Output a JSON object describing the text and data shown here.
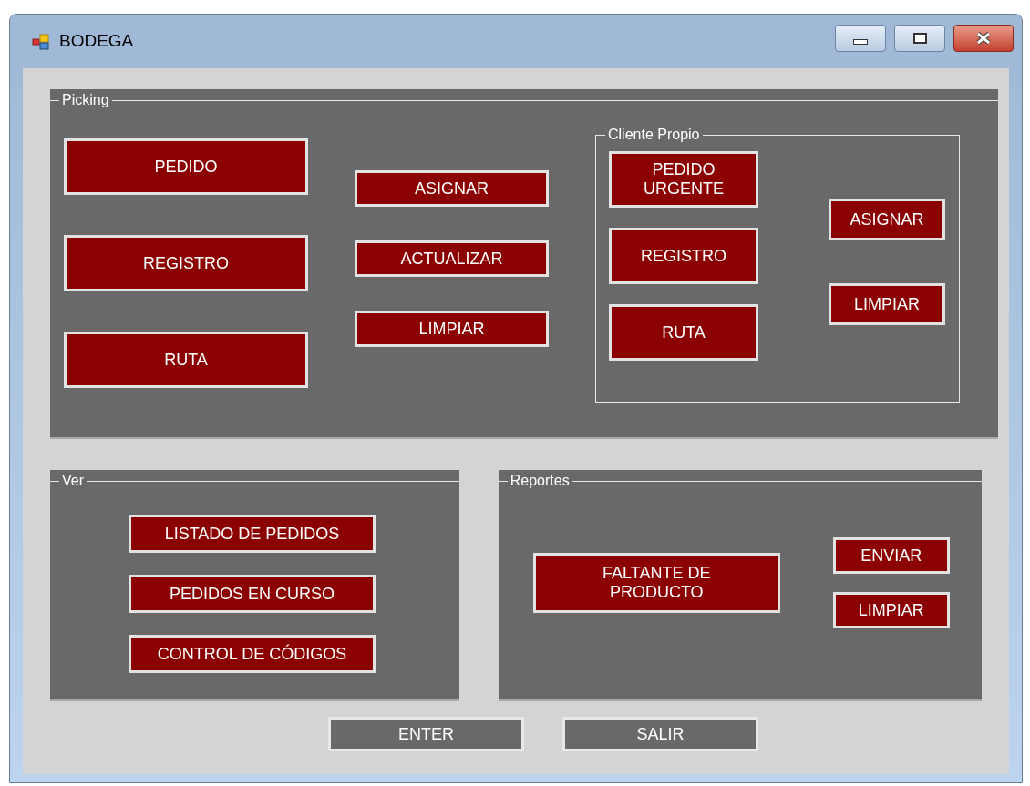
{
  "window": {
    "title": "BODEGA"
  },
  "picking": {
    "title": "Picking",
    "columns": [
      [
        {
          "label": "PEDIDO",
          "kind": "accent"
        },
        {
          "label": "REGISTRO",
          "kind": "accent"
        },
        {
          "label": "RUTA",
          "kind": "accent"
        }
      ],
      [
        {
          "label": "ASIGNAR",
          "kind": "accent"
        },
        {
          "label": "ACTUALIZAR",
          "kind": "accent"
        },
        {
          "label": "LIMPIAR",
          "kind": "accent"
        }
      ]
    ],
    "cliente_propio": {
      "title": "Cliente Propio",
      "columns": [
        [
          {
            "label": "PEDIDO\nURGENTE",
            "kind": "accent"
          },
          {
            "label": "REGISTRO",
            "kind": "accent"
          },
          {
            "label": "RUTA",
            "kind": "accent"
          }
        ],
        [
          {
            "label": "ASIGNAR",
            "kind": "accent"
          },
          {
            "label": "LIMPIAR",
            "kind": "accent"
          }
        ]
      ]
    }
  },
  "ver": {
    "title": "Ver",
    "buttons": [
      {
        "label": "LISTADO DE PEDIDOS",
        "kind": "accent"
      },
      {
        "label": "PEDIDOS EN CURSO",
        "kind": "accent"
      },
      {
        "label": "CONTROL DE CÓDIGOS",
        "kind": "accent"
      }
    ]
  },
  "reportes": {
    "title": "Reportes",
    "main": {
      "label": "FALTANTE DE\nPRODUCTO",
      "kind": "accent"
    },
    "buttons": [
      {
        "label": "ENVIAR",
        "kind": "accent"
      },
      {
        "label": "LIMPIAR",
        "kind": "accent"
      }
    ]
  },
  "footer": [
    {
      "label": "ENTER",
      "kind": "plain"
    },
    {
      "label": "SALIR",
      "kind": "plain"
    }
  ]
}
